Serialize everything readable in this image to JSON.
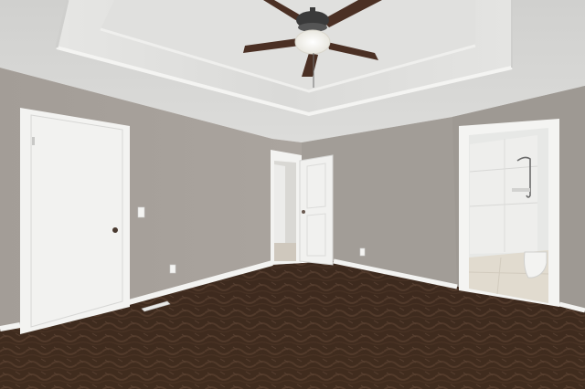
{
  "scene": {
    "kind": "empty-bedroom-interior",
    "elements": [
      "tray-ceiling",
      "ceiling-fan-with-light",
      "closed-white-door",
      "open-white-door",
      "bathroom-doorway",
      "light-switch",
      "power-outlet",
      "floor-vent",
      "baseboard",
      "patterned-carpet"
    ],
    "colors": {
      "wall_left": "#a59f99",
      "wall_back": "#a29d97",
      "wall_right": "#9e9993",
      "ceiling": "#d8d8d6",
      "tray_ceiling": "#e3e3e1",
      "trim": "#f3f3f1",
      "door": "#f2f2f0",
      "carpet": "#3e2a1e",
      "carpet_pattern": "#5b4131",
      "fan_blade": "#4b3024",
      "fan_hub": "#3a3a3a",
      "fan_light": "#f7f6f0",
      "bathroom_wall": "#e7e8e6",
      "bathroom_floor": "#e1dbcf"
    }
  }
}
